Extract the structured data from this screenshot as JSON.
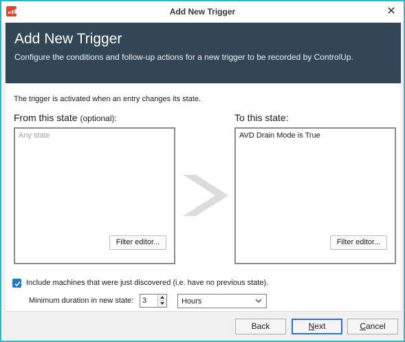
{
  "window": {
    "title": "Add New Trigger",
    "accent_color": "#2ab7c9",
    "app_icon": "controlup-logo-icon",
    "close_icon": "close-icon",
    "close_glyph": "✕"
  },
  "header": {
    "title": "Add New Trigger",
    "subtitle": "Configure the conditions and follow-up actions for a new trigger to be recorded by ControlUp.",
    "background_color": "#324655"
  },
  "body": {
    "description": "The trigger is activated when an entry changes its state.",
    "from_state": {
      "label": "From this state",
      "optional_note": "(optional):",
      "placeholder": "Any state",
      "filter_button": "Filter editor..."
    },
    "arrow_icon": "chevron-right-icon",
    "to_state": {
      "label": "To this state:",
      "value": "AVD Drain Mode is True",
      "filter_button": "Filter editor..."
    },
    "include_new": {
      "checked": true,
      "label": "Include machines that were just discovered (i.e. have no previous state)."
    },
    "duration": {
      "label": "Minimum duration in new state:",
      "value": "3",
      "unit": "Hours"
    }
  },
  "footer": {
    "back": "Back",
    "next_first": "N",
    "next_rest": "ext",
    "cancel_first": "C",
    "cancel_rest": "ancel",
    "default_button_color": "#2a6fd6"
  }
}
